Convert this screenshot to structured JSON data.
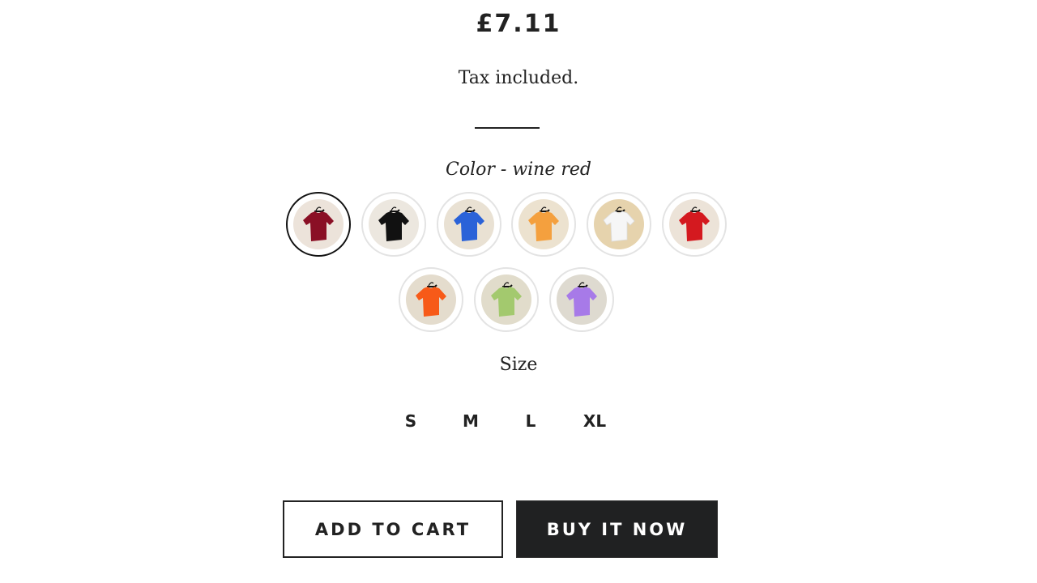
{
  "product": {
    "price": "£7.11",
    "tax_note": "Tax included."
  },
  "color": {
    "label_prefix": "Color - ",
    "selected": "wine red",
    "options": [
      {
        "name": "wine red",
        "hex": "#8a0f25",
        "bg": "#ece3da",
        "selected": true
      },
      {
        "name": "black",
        "hex": "#111111",
        "bg": "#ece7df",
        "selected": false
      },
      {
        "name": "blue",
        "hex": "#2a62d8",
        "bg": "#e9e1d3",
        "selected": false
      },
      {
        "name": "orange",
        "hex": "#f4a03e",
        "bg": "#ece2cf",
        "selected": false
      },
      {
        "name": "white",
        "hex": "#f6f6f6",
        "bg": "#e6d3ad",
        "selected": false
      },
      {
        "name": "red",
        "hex": "#d4191f",
        "bg": "#ece3d8",
        "selected": false
      },
      {
        "name": "bright orange",
        "hex": "#f75a18",
        "bg": "#e4dccd",
        "selected": false
      },
      {
        "name": "light green",
        "hex": "#a3c96e",
        "bg": "#e1dccb",
        "selected": false
      },
      {
        "name": "purple",
        "hex": "#a77ae8",
        "bg": "#dedad0",
        "selected": false
      }
    ]
  },
  "size": {
    "label": "Size",
    "options": [
      {
        "label": "S",
        "selected": true
      },
      {
        "label": "M",
        "selected": false
      },
      {
        "label": "L",
        "selected": false
      },
      {
        "label": "XL",
        "selected": false
      }
    ]
  },
  "actions": {
    "add_to_cart": "ADD TO CART",
    "buy_now": "BUY IT NOW"
  }
}
